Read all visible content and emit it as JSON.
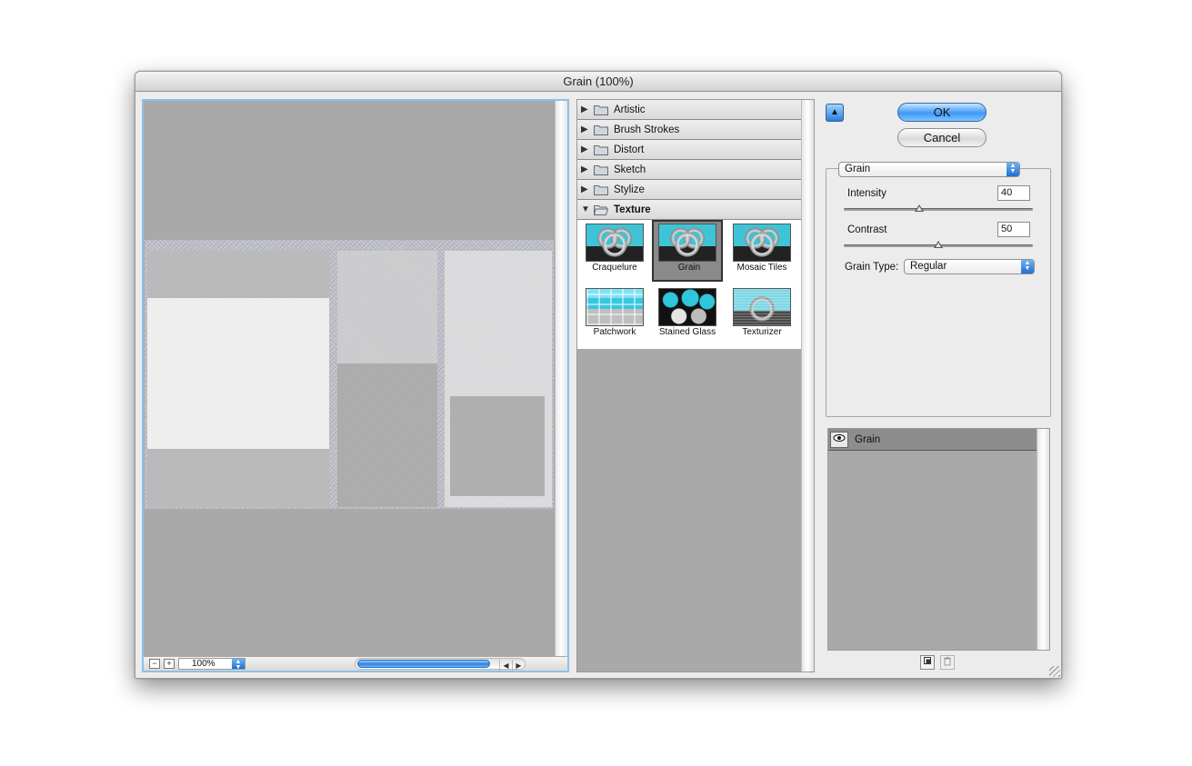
{
  "window": {
    "title": "Grain (100%)"
  },
  "preview": {
    "zoom_out": "−",
    "zoom_in": "+",
    "zoom_value": "100%",
    "scroll_left": "◀",
    "scroll_right": "▶"
  },
  "filter_categories": [
    {
      "label": "Artistic",
      "expanded": false
    },
    {
      "label": "Brush Strokes",
      "expanded": false
    },
    {
      "label": "Distort",
      "expanded": false
    },
    {
      "label": "Sketch",
      "expanded": false
    },
    {
      "label": "Stylize",
      "expanded": false
    },
    {
      "label": "Texture",
      "expanded": true
    }
  ],
  "texture_filters": [
    {
      "label": "Craquelure",
      "thumb": "knot"
    },
    {
      "label": "Grain",
      "thumb": "knot",
      "selected": true
    },
    {
      "label": "Mosaic Tiles",
      "thumb": "knot"
    },
    {
      "label": "Patchwork",
      "thumb": "patch"
    },
    {
      "label": "Stained Glass",
      "thumb": "stained"
    },
    {
      "label": "Texturizer",
      "thumb": "texturizer"
    }
  ],
  "buttons": {
    "ok": "OK",
    "cancel": "Cancel",
    "collapse": "▲"
  },
  "settings": {
    "filter_select": "Grain",
    "intensity_label": "Intensity",
    "intensity_value": "40",
    "intensity_level": 0.4,
    "contrast_label": "Contrast",
    "contrast_value": "50",
    "contrast_level": 0.5,
    "grain_type_label": "Grain Type:",
    "grain_type_value": "Regular"
  },
  "layers": [
    {
      "name": "Grain",
      "visible_icon": "eye-icon"
    }
  ],
  "icons": {
    "popup": "popup-arrows-icon",
    "new_layer": "new-effect-layer-icon",
    "delete_layer": "trash-icon"
  },
  "colors": {
    "accent": "#3f98f5",
    "panel": "#a9a9a9"
  }
}
